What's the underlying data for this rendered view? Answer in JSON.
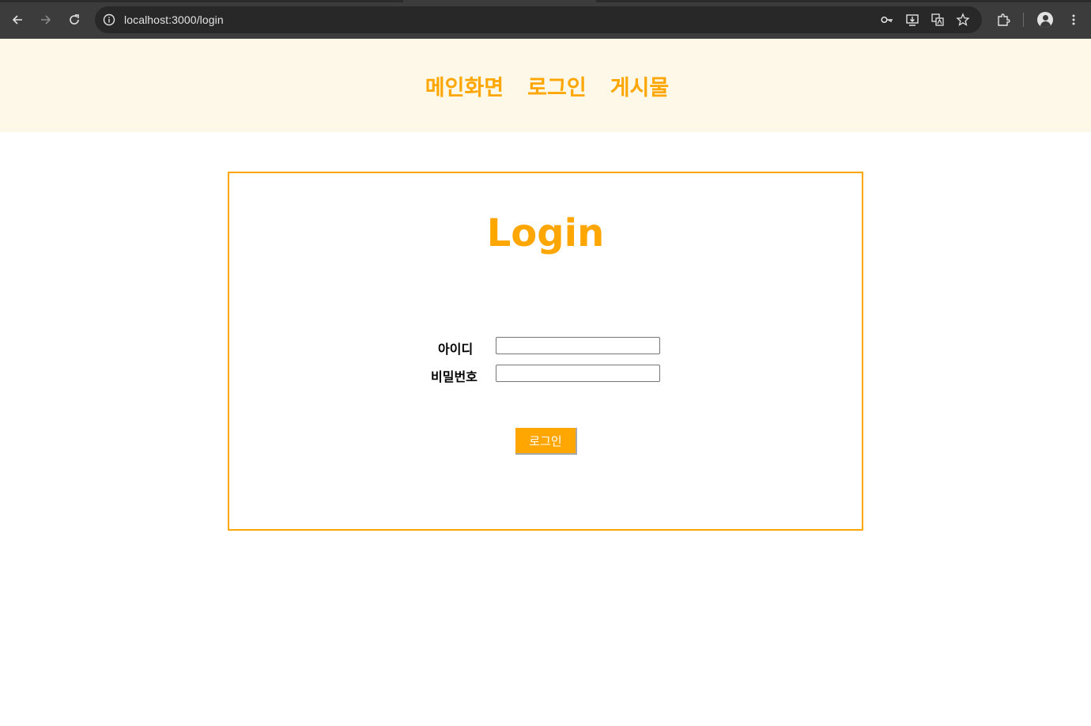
{
  "browser": {
    "url": "localhost:3000/login",
    "icons": {
      "back": "arrow-left-icon",
      "forward": "arrow-right-icon",
      "reload": "reload-icon",
      "site_info": "info-icon",
      "password": "key-icon",
      "install": "install-app-icon",
      "translate": "translate-icon",
      "bookmark": "star-icon",
      "extensions": "puzzle-icon",
      "profile": "profile-icon",
      "menu": "more-vert-icon"
    }
  },
  "nav": {
    "items": [
      {
        "label": "메인화면"
      },
      {
        "label": "로그인"
      },
      {
        "label": "게시물"
      }
    ]
  },
  "login": {
    "title": "Login",
    "id_label": "아이디",
    "id_value": "",
    "password_label": "비밀번호",
    "password_value": "",
    "submit_label": "로그인"
  },
  "colors": {
    "accent": "#ffa600",
    "nav_background": "#fef8e8",
    "chrome_background": "#3c3c3c",
    "omnibox_background": "#282828"
  }
}
